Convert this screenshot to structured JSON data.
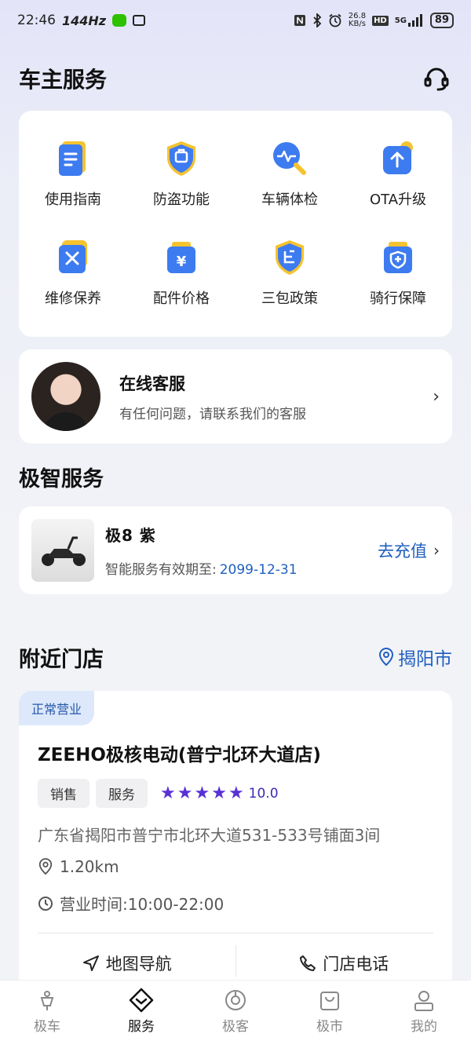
{
  "status_bar": {
    "time": "22:46",
    "refresh_rate": "144Hz",
    "net_speed_value": "26.8",
    "net_speed_unit": "KB/s",
    "hd_label": "HD",
    "network_label": "5G",
    "battery": "89"
  },
  "header": {
    "title": "车主服务",
    "support_icon": "headset-icon"
  },
  "services": [
    {
      "label": "使用指南",
      "icon": "guide-doc-icon"
    },
    {
      "label": "防盗功能",
      "icon": "anti-theft-shield-icon"
    },
    {
      "label": "车辆体检",
      "icon": "vehicle-check-icon"
    },
    {
      "label": "OTA升级",
      "icon": "ota-upgrade-icon"
    },
    {
      "label": "维修保养",
      "icon": "maintenance-wrench-icon"
    },
    {
      "label": "配件价格",
      "icon": "parts-price-icon"
    },
    {
      "label": "三包政策",
      "icon": "warranty-policy-icon"
    },
    {
      "label": "骑行保障",
      "icon": "ride-protection-icon"
    }
  ],
  "online_service": {
    "title": "在线客服",
    "subtitle": "有任何问题，请联系我们的客服"
  },
  "smart_service": {
    "section_title": "极智服务",
    "vehicle_name": "极8 紫",
    "validity_label": "智能服务有效期至:",
    "validity_date": "2099-12-31",
    "recharge_label": "去充值"
  },
  "nearby": {
    "section_title": "附近门店",
    "city": "揭阳市",
    "store": {
      "status": "正常营业",
      "name": "ZEEHO极核电动(普宁北环大道店)",
      "tags": [
        "销售",
        "服务"
      ],
      "stars": 5,
      "rating": "10.0",
      "address": "广东省揭阳市普宁市北环大道531-533号铺面3间",
      "distance": "1.20km",
      "hours": "营业时间:10:00-22:00",
      "nav_label": "地图导航",
      "phone_label": "门店电话"
    }
  },
  "tab_bar": [
    {
      "label": "极车",
      "icon": "scooter-icon",
      "active": false
    },
    {
      "label": "服务",
      "icon": "service-diamond-icon",
      "active": true
    },
    {
      "label": "极客",
      "icon": "geek-icon",
      "active": false
    },
    {
      "label": "极市",
      "icon": "shopping-bag-icon",
      "active": false
    },
    {
      "label": "我的",
      "icon": "profile-icon",
      "active": false
    }
  ],
  "colors": {
    "accent_blue": "#1f5fbf",
    "star_purple": "#5a31d6",
    "icon_blue": "#3d7bf0",
    "icon_yellow": "#f5c330"
  }
}
